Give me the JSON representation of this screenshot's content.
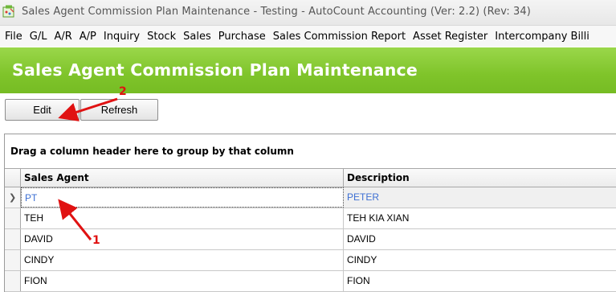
{
  "window": {
    "title": "Sales Agent Commission Plan Maintenance - Testing - AutoCount Accounting (Ver: 2.2) (Rev: 34)",
    "icon": "autocount-app-icon"
  },
  "menu": {
    "items": [
      "File",
      "G/L",
      "A/R",
      "A/P",
      "Inquiry",
      "Stock",
      "Sales",
      "Purchase",
      "Sales Commission Report",
      "Asset Register",
      "Intercompany Billi"
    ]
  },
  "header": {
    "title": "Sales Agent Commission Plan Maintenance",
    "color": "#7fc42a"
  },
  "toolbar": {
    "edit_label": "Edit",
    "refresh_label": "Refresh"
  },
  "grid": {
    "group_hint": "Drag a column header here to group by that column",
    "columns": [
      "Sales Agent",
      "Description"
    ],
    "rows": [
      {
        "agent": "PT",
        "description": "PETER",
        "selected": true
      },
      {
        "agent": "TEH",
        "description": "TEH KIA XIAN"
      },
      {
        "agent": "DAVID",
        "description": "DAVID"
      },
      {
        "agent": "CINDY",
        "description": "CINDY"
      },
      {
        "agent": "FION",
        "description": "FION"
      }
    ],
    "selected_text_color": "#3d6fd3"
  },
  "annotations": {
    "labels": [
      "1",
      "2"
    ],
    "color": "#e01212"
  }
}
